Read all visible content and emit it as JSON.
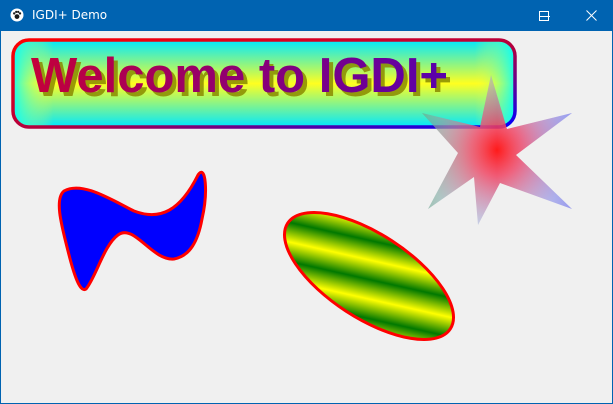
{
  "window": {
    "title": "IGDI+ Demo",
    "app_icon": "paw-icon",
    "controls": {
      "minimize_icon": "minimize-icon",
      "maximize_icon": "maximize-icon",
      "close_icon": "close-icon"
    },
    "titlebar_color": "#0063b1",
    "client_background": "#f0f0f0"
  },
  "drawing": {
    "banner_text": "Welcome to IGDI+",
    "banner_text_gradient": [
      "#c0003f",
      "#5a00a8"
    ],
    "banner_fill_gradient": [
      "#00ffff",
      "#ffff00"
    ],
    "banner_border_gradient": [
      "#ff0000",
      "#0000ff"
    ],
    "blob_fill": "#0000ff",
    "blob_stroke": "#ff0000",
    "ellipse_stripes": [
      "#008000",
      "#ffff00"
    ],
    "ellipse_stroke": "#ff0000",
    "star_center_color": "#ff0000",
    "star_outer_colors": [
      "#00a000",
      "#0000ff",
      "#808080"
    ]
  }
}
